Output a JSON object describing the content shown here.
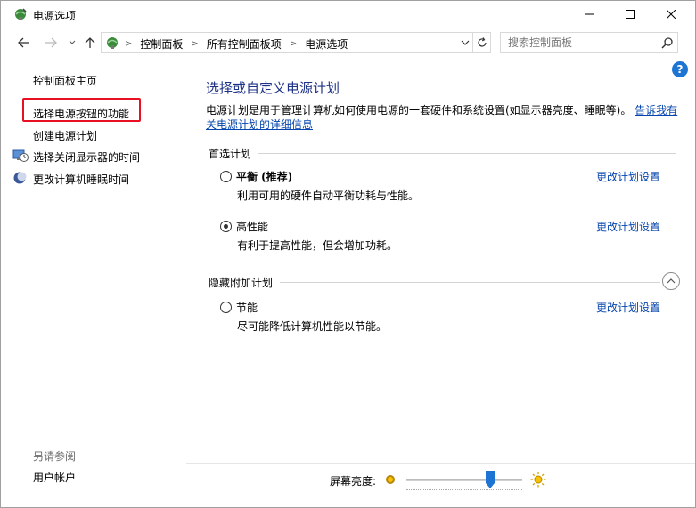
{
  "window": {
    "title": "电源选项",
    "controls": {
      "minimize": "—",
      "maximize": "☐",
      "close": "✕"
    }
  },
  "address": {
    "breadcrumbs": [
      "控制面板",
      "所有控制面板项",
      "电源选项"
    ],
    "search_placeholder": "搜索控制面板"
  },
  "sidebar": {
    "home": "控制面板主页",
    "choose_power_button": "选择电源按钮的功能",
    "create_plan": "创建电源计划",
    "turn_off_display": "选择关闭显示器的时间",
    "sleep_time": "更改计算机睡眠时间",
    "see_also": "另请参阅",
    "user_accounts": "用户帐户"
  },
  "main": {
    "title": "选择或自定义电源计划",
    "description": "电源计划是用于管理计算机如何使用电源的一套硬件和系统设置(如显示器亮度、睡眠等)。",
    "learn_more_part1": "告诉我有",
    "learn_more_part2": "关电源计划的详细信息",
    "preferred_header": "首选计划",
    "hidden_header": "隐藏附加计划",
    "plans": [
      {
        "name": "平衡 (推荐)",
        "description": "利用可用的硬件自动平衡功耗与性能。",
        "link": "更改计划设置",
        "selected": false
      },
      {
        "name": "高性能",
        "description": "有利于提高性能，但会增加功耗。",
        "link": "更改计划设置",
        "selected": true
      },
      {
        "name": "节能",
        "description": "尽可能降低计算机性能以节能。",
        "link": "更改计划设置",
        "selected": false
      }
    ]
  },
  "footer": {
    "brightness_label": "屏幕亮度:",
    "brightness_level": 0.72
  },
  "colors": {
    "title_blue": "#1e3287",
    "link_blue": "#0645ad",
    "highlight_red": "#e81123",
    "help_blue": "#1e74d2"
  }
}
